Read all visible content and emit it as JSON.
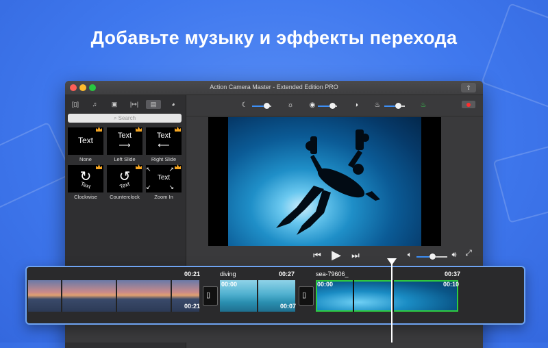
{
  "headline": "Добавьте музыку и эффекты перехода",
  "window": {
    "title": "Action Camera Master - Extended Edition PRO"
  },
  "sidebar": {
    "tabs": [
      {
        "icon": "film-icon",
        "glyph": "[▯]"
      },
      {
        "icon": "music-icon",
        "glyph": "♫"
      },
      {
        "icon": "photo-icon",
        "glyph": "▣"
      },
      {
        "icon": "transition-icon",
        "glyph": "|↦|"
      },
      {
        "icon": "text-effects-icon",
        "glyph": "▤"
      },
      {
        "icon": "filter-icon",
        "glyph": "◕"
      }
    ],
    "search_placeholder": "Search",
    "effects": [
      {
        "label": "None",
        "thumb": "Text"
      },
      {
        "label": "Left Slide",
        "thumb": "Text"
      },
      {
        "label": "Right Slide",
        "thumb": "Text"
      },
      {
        "label": "Clockwise",
        "thumb": "Text"
      },
      {
        "label": "Counterclock",
        "thumb": "Text"
      },
      {
        "label": "Zoom In",
        "thumb": "Text"
      }
    ]
  },
  "toolbar": {
    "brightness_level": 0.75,
    "contrast_level": 0.75,
    "saturation_level": 0.65,
    "accent": "#3d8ff6"
  },
  "player": {
    "volume_level": 0.5
  },
  "timeline": {
    "clips": [
      {
        "name": "",
        "end_time": "00:21",
        "start_time": "",
        "bottom_time": "00:21"
      },
      {
        "name": "diving",
        "end_time": "00:27",
        "start_time": "00:00",
        "bottom_time": "00:07"
      },
      {
        "name": "sea-79606_",
        "end_time": "00:37",
        "start_time": "00:00",
        "bottom_time": "00:10"
      }
    ],
    "selected_clip_color": "#2ecc40"
  }
}
